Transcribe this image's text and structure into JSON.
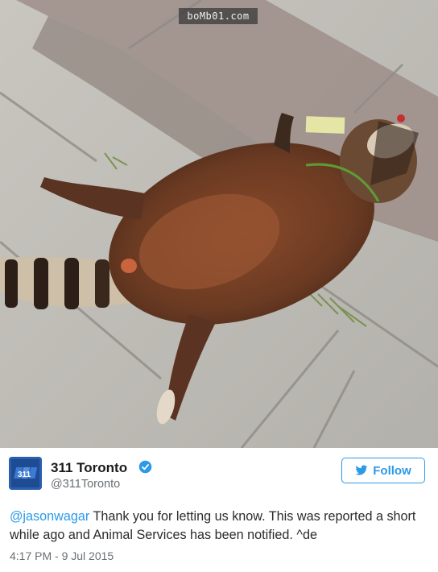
{
  "watermark": "boMb01.com",
  "tweet": {
    "display_name": "311 Toronto",
    "handle": "@311Toronto",
    "follow_label": "Follow",
    "mention": "@jasonwagar",
    "body": " Thank you for letting us know. This was reported a short while ago and Animal Services has been notified. ^de",
    "timestamp": "4:17 PM - 9 Jul 2015",
    "avatar_text": "311"
  },
  "colors": {
    "accent": "#2b9ae8",
    "text": "#1b1b1b",
    "muted": "#6a6f74",
    "avatar_bg": "#2b5fae"
  },
  "icons": [
    "twitter-bird-icon",
    "verified-badge-icon"
  ]
}
